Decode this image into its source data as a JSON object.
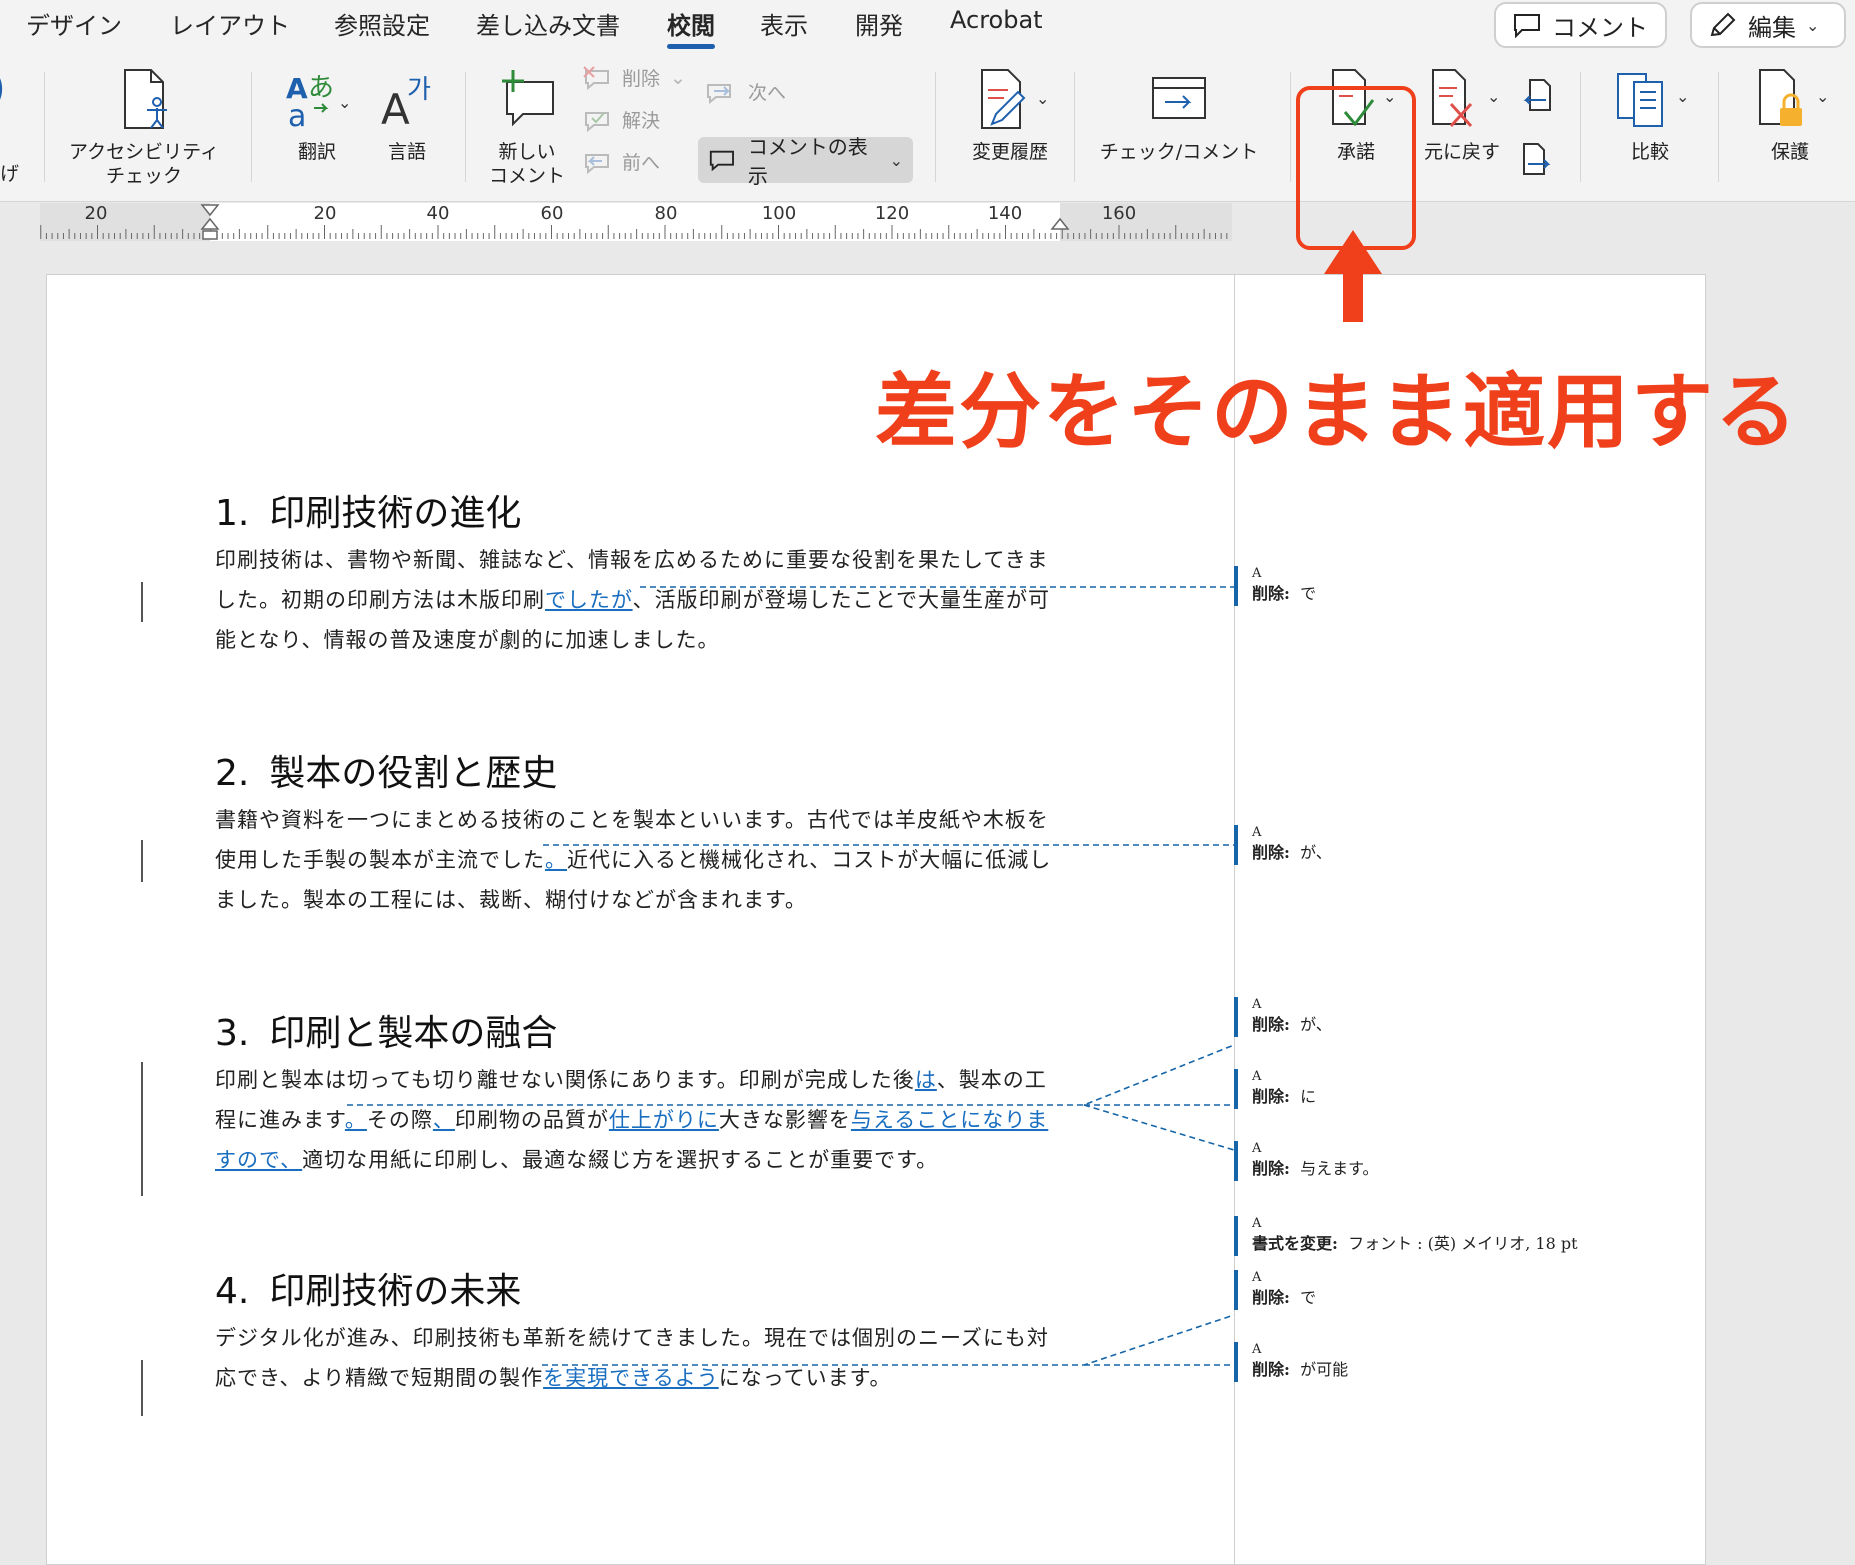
{
  "tabs": [
    {
      "label": "デザイン"
    },
    {
      "label": "レイアウト"
    },
    {
      "label": "参照設定"
    },
    {
      "label": "差し込み文書"
    },
    {
      "label": "校閲"
    },
    {
      "label": "表示"
    },
    {
      "label": "開発"
    },
    {
      "label": "Acrobat"
    }
  ],
  "active_tab": "校閲",
  "top_right": {
    "comment_label": "コメント",
    "edit_label": "編集"
  },
  "ribbon": {
    "partial_left_label": "げ",
    "accessibility": {
      "line1": "アクセシビリティ",
      "line2": "チェック"
    },
    "translate": "翻訳",
    "language": "言語",
    "new_comment": {
      "line1": "新しい",
      "line2": "コメント"
    },
    "delete": "削除",
    "resolve": "解決",
    "previous": "前へ",
    "next": "次へ",
    "show_comments": "コメントの表示",
    "track_changes": "変更履歴",
    "check_comment": "チェック/コメント",
    "accept": "承諾",
    "reject": "元に戻す",
    "compare": "比較",
    "protect": "保護"
  },
  "ruler": {
    "labels": [
      "20",
      "20",
      "40",
      "60",
      "80",
      "100",
      "120",
      "140",
      "160"
    ]
  },
  "annotation": {
    "text": "差分をそのまま適用する"
  },
  "document": {
    "sections": [
      {
        "number": "1.",
        "title": "印刷技術の進化",
        "lines": [
          [
            {
              "t": "印刷技術は、書物や新聞、雑誌など、情報を広めるために重要な役割を果たしてきま"
            }
          ],
          [
            {
              "t": "した。初期の印刷方法は木版印刷"
            },
            {
              "t": "でしたが",
              "ins": true
            },
            {
              "t": "、活版印刷が登場したことで大量生産が可"
            }
          ],
          [
            {
              "t": "能となり、情報の普及速度が劇的に加速しました。"
            }
          ]
        ]
      },
      {
        "number": "2.",
        "title": "製本の役割と歴史",
        "lines": [
          [
            {
              "t": "書籍や資料を一つにまとめる技術のことを製本といいます。古代では羊皮紙や木板を"
            }
          ],
          [
            {
              "t": "使用した手製の製本が主流でした"
            },
            {
              "t": "。",
              "ins": true
            },
            {
              "t": "近代に入ると機械化され、コストが大幅に低減し"
            }
          ],
          [
            {
              "t": "ました。製本の工程には、裁断、糊付けなどが含まれます。"
            }
          ]
        ]
      },
      {
        "number": "3.",
        "title": "印刷と製本の融合",
        "lines": [
          [
            {
              "t": "印刷と製本は切っても切り離せない関係にあります。印刷が完成した後"
            },
            {
              "t": "は",
              "ins": true
            },
            {
              "t": "、製本の工"
            }
          ],
          [
            {
              "t": "程に進みます"
            },
            {
              "t": "。",
              "ins": true
            },
            {
              "t": "その際"
            },
            {
              "t": "、",
              "ins": true
            },
            {
              "t": "印刷物の品質が"
            },
            {
              "t": "仕上がりに",
              "ins": true
            },
            {
              "t": "大きな影響を"
            },
            {
              "t": "与えることになりま",
              "ins": true
            }
          ],
          [
            {
              "t": "すので、",
              "ins": true
            },
            {
              "t": "適切な用紙に印刷し、最適な綴じ方を選択することが重要です。"
            }
          ]
        ]
      },
      {
        "number": "4.",
        "title": "印刷技術の未来",
        "lines": [
          [
            {
              "t": "デジタル化が進み、印刷技術も革新を続けてきました。現在では個別のニーズにも対"
            }
          ],
          [
            {
              "t": "応でき、より精緻で短期間の製作"
            },
            {
              "t": "を実現できるよう",
              "ins": true
            },
            {
              "t": "になっています。"
            }
          ]
        ]
      }
    ],
    "balloons": [
      {
        "author": "A",
        "label": "削除:",
        "text": "で"
      },
      {
        "author": "A",
        "label": "削除:",
        "text": "が、"
      },
      {
        "author": "A",
        "label": "削除:",
        "text": "が、"
      },
      {
        "author": "A",
        "label": "削除:",
        "text": "に"
      },
      {
        "author": "A",
        "label": "削除:",
        "text": "与えます。"
      },
      {
        "author": "A",
        "label": "書式を変更:",
        "text": "フォント : (英) メイリオ, 18 pt"
      },
      {
        "author": "A",
        "label": "削除:",
        "text": "で"
      },
      {
        "author": "A",
        "label": "削除:",
        "text": "が可能"
      }
    ]
  },
  "colors": {
    "accent": "#1e5fae",
    "insertion": "#1a6ec0",
    "callout": "#f0401b",
    "balloon_bar": "#1565a8"
  }
}
